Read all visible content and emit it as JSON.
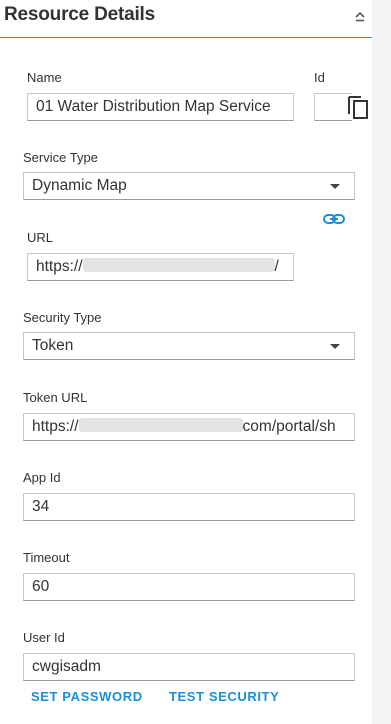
{
  "header": {
    "title": "Resource Details",
    "collapse_icon": "chevron-up-icon"
  },
  "fields": {
    "name": {
      "label": "Name",
      "value": "01 Water Distribution Map Service"
    },
    "id": {
      "label": "Id",
      "value": "",
      "copy_icon": "copy-icon"
    },
    "service_type": {
      "label": "Service Type",
      "value": "Dynamic Map"
    },
    "url": {
      "label": "URL",
      "value_prefix": "https://",
      "value_suffix": "/",
      "link_icon": "link-icon"
    },
    "security_type": {
      "label": "Security Type",
      "value": "Token"
    },
    "token_url": {
      "label": "Token URL",
      "value_prefix": "https://",
      "value_suffix": "com/portal/sh"
    },
    "app_id": {
      "label": "App Id",
      "value": "34"
    },
    "timeout": {
      "label": "Timeout",
      "value": "60"
    },
    "user_id": {
      "label": "User Id",
      "value": "cwgisadm"
    }
  },
  "actions": {
    "set_password": "SET PASSWORD",
    "test_security": "TEST SECURITY"
  },
  "colors": {
    "accent": "#1a8fd6",
    "header_rule": "#2d8fd0",
    "field_border": "#c7c7c7"
  }
}
